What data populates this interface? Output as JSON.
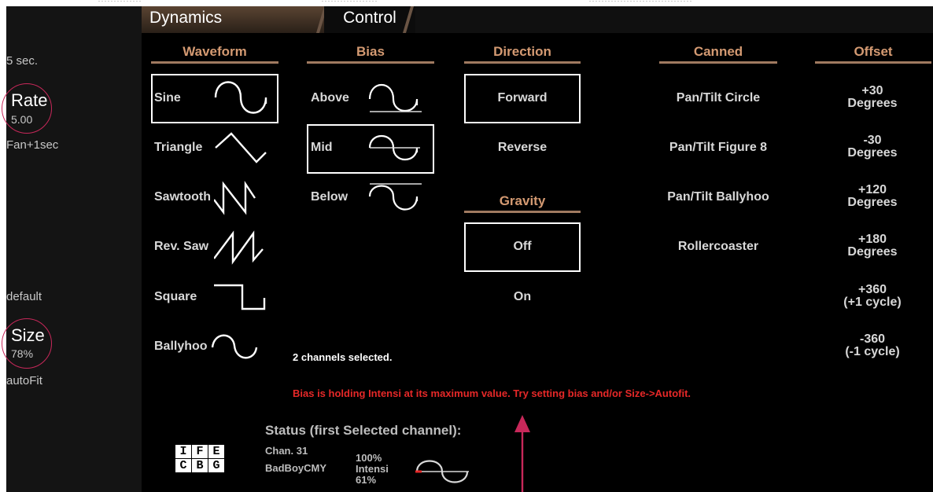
{
  "tabs": {
    "dynamics": "Dynamics",
    "control": "Control"
  },
  "sidebar": {
    "duration": "5 sec.",
    "rate_label": "Rate",
    "rate_value": "5.00",
    "fan": "Fan+1sec",
    "size_default": "default",
    "size_label": "Size",
    "size_value": "78%",
    "autofit": "autoFit"
  },
  "headers": {
    "waveform": "Waveform",
    "bias": "Bias",
    "direction": "Direction",
    "canned": "Canned",
    "offset": "Offset",
    "gravity": "Gravity"
  },
  "waveform": [
    "Sine",
    "Triangle",
    "Sawtooth",
    "Rev. Saw",
    "Square",
    "Ballyhoo"
  ],
  "waveform_selected": "Sine",
  "bias": [
    "Above",
    "Mid",
    "Below"
  ],
  "bias_selected": "Mid",
  "direction": [
    "Forward",
    "Reverse"
  ],
  "direction_selected": "Forward",
  "gravity": [
    "Off",
    "On"
  ],
  "gravity_selected": "Off",
  "canned": [
    "Pan/Tilt Circle",
    "Pan/Tilt Figure 8",
    "Pan/Tilt Ballyhoo",
    "Rollercoaster"
  ],
  "offset": [
    {
      "top": "+30",
      "bottom": "Degrees"
    },
    {
      "top": "-30",
      "bottom": "Degrees"
    },
    {
      "top": "+120",
      "bottom": "Degrees"
    },
    {
      "top": "+180",
      "bottom": "Degrees"
    },
    {
      "top": "+360",
      "bottom": "(+1 cycle)"
    },
    {
      "top": "-360",
      "bottom": "(-1 cycle)"
    }
  ],
  "messages": {
    "selected": "2 channels selected.",
    "warning": "Bias is holding Intensi at its maximum value.  Try setting bias and/or Size->Autofit."
  },
  "status": {
    "title": "Status (first Selected channel):",
    "channel": "Chan. 31",
    "fixture": "BadBoyCMY",
    "percent": "100%",
    "param": "Intensi",
    "level": "61%",
    "grid": [
      "I",
      "F",
      "E",
      "C",
      "B",
      "G"
    ]
  },
  "colors": {
    "header": "#d49a72",
    "warning": "#e62828",
    "annotation": "#c8285a"
  }
}
